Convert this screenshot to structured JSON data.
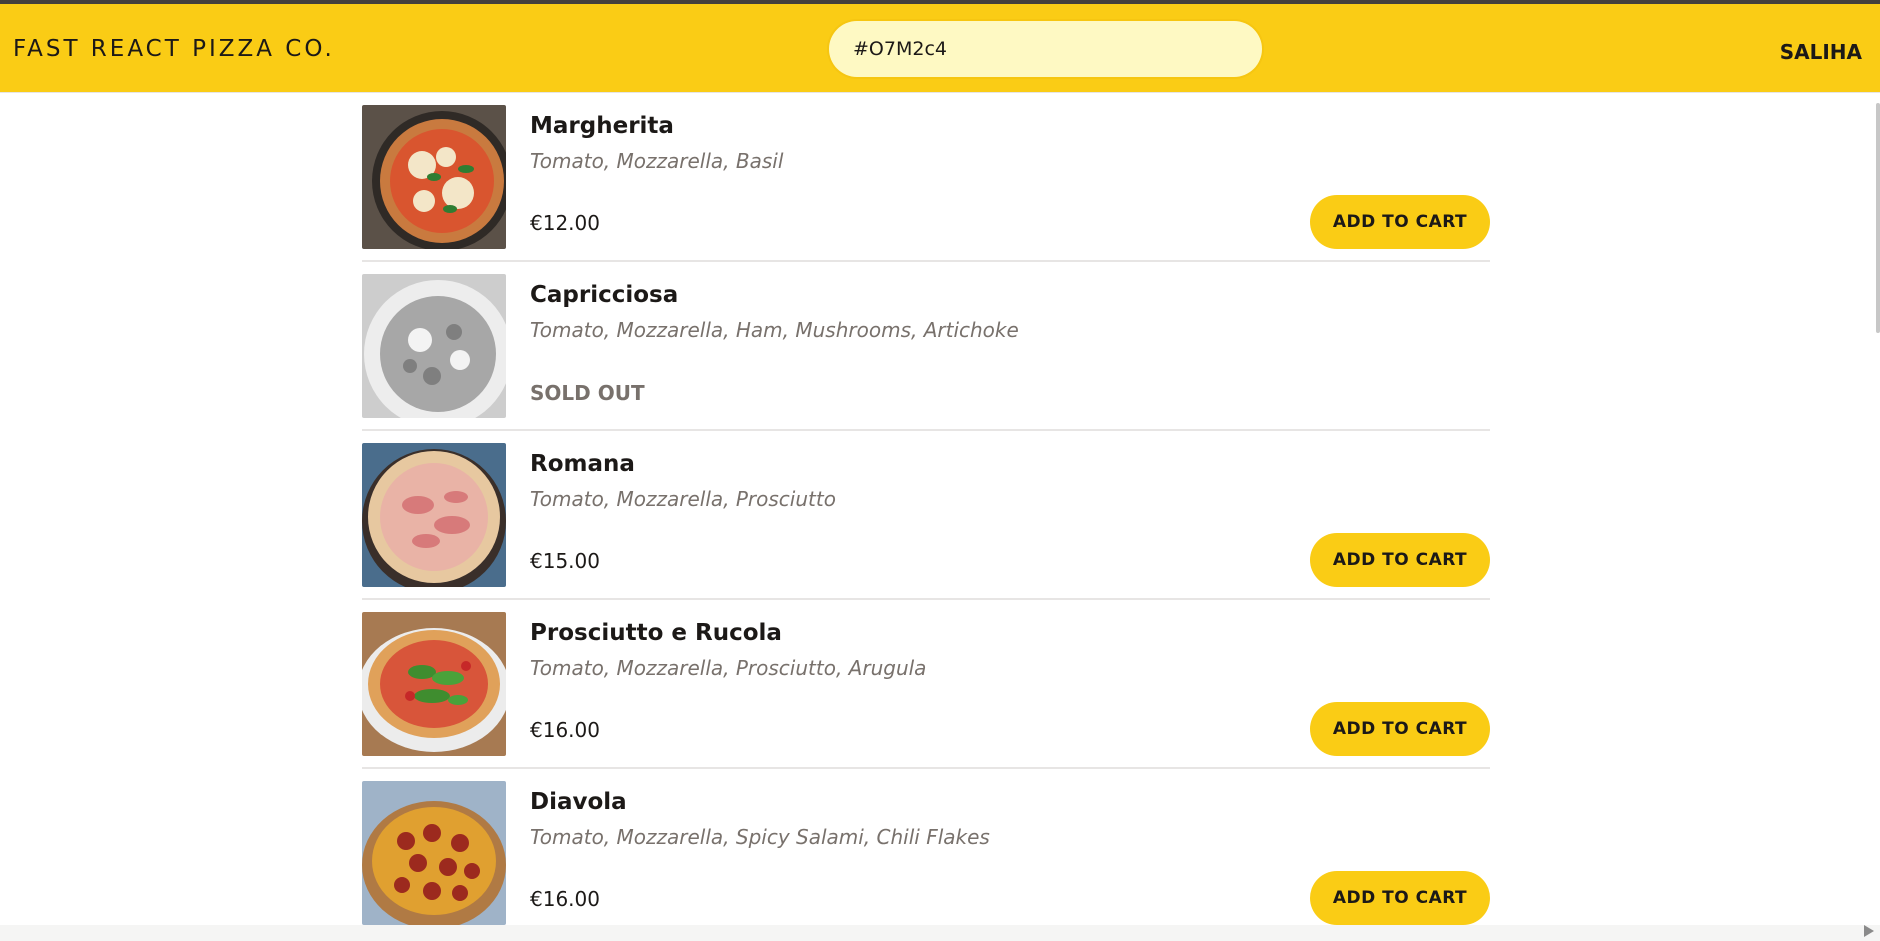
{
  "header": {
    "logo": "Fast React Pizza Co.",
    "search_value": "#O7M2c4",
    "username": "Saliha"
  },
  "menu": {
    "add_label": "Add to cart",
    "sold_out_label": "Sold out",
    "items": [
      {
        "name": "Margherita",
        "ingredients": "Tomato, Mozzarella, Basil",
        "price": "€12.00",
        "sold_out": false,
        "image_icon": "pizza-margherita-photo"
      },
      {
        "name": "Capricciosa",
        "ingredients": "Tomato, Mozzarella, Ham, Mushrooms, Artichoke",
        "price": "",
        "sold_out": true,
        "image_icon": "pizza-capricciosa-photo"
      },
      {
        "name": "Romana",
        "ingredients": "Tomato, Mozzarella, Prosciutto",
        "price": "€15.00",
        "sold_out": false,
        "image_icon": "pizza-romana-photo"
      },
      {
        "name": "Prosciutto e Rucola",
        "ingredients": "Tomato, Mozzarella, Prosciutto, Arugula",
        "price": "€16.00",
        "sold_out": false,
        "image_icon": "pizza-prosciutto-rucola-photo"
      },
      {
        "name": "Diavola",
        "ingredients": "Tomato, Mozzarella, Spicy Salami, Chili Flakes",
        "price": "€16.00",
        "sold_out": false,
        "image_icon": "pizza-diavola-photo"
      }
    ]
  },
  "colors": {
    "brand_yellow": "#facc15",
    "search_bg": "#fef9c3",
    "muted_text": "#78716c",
    "divider": "#e7e5e4"
  }
}
